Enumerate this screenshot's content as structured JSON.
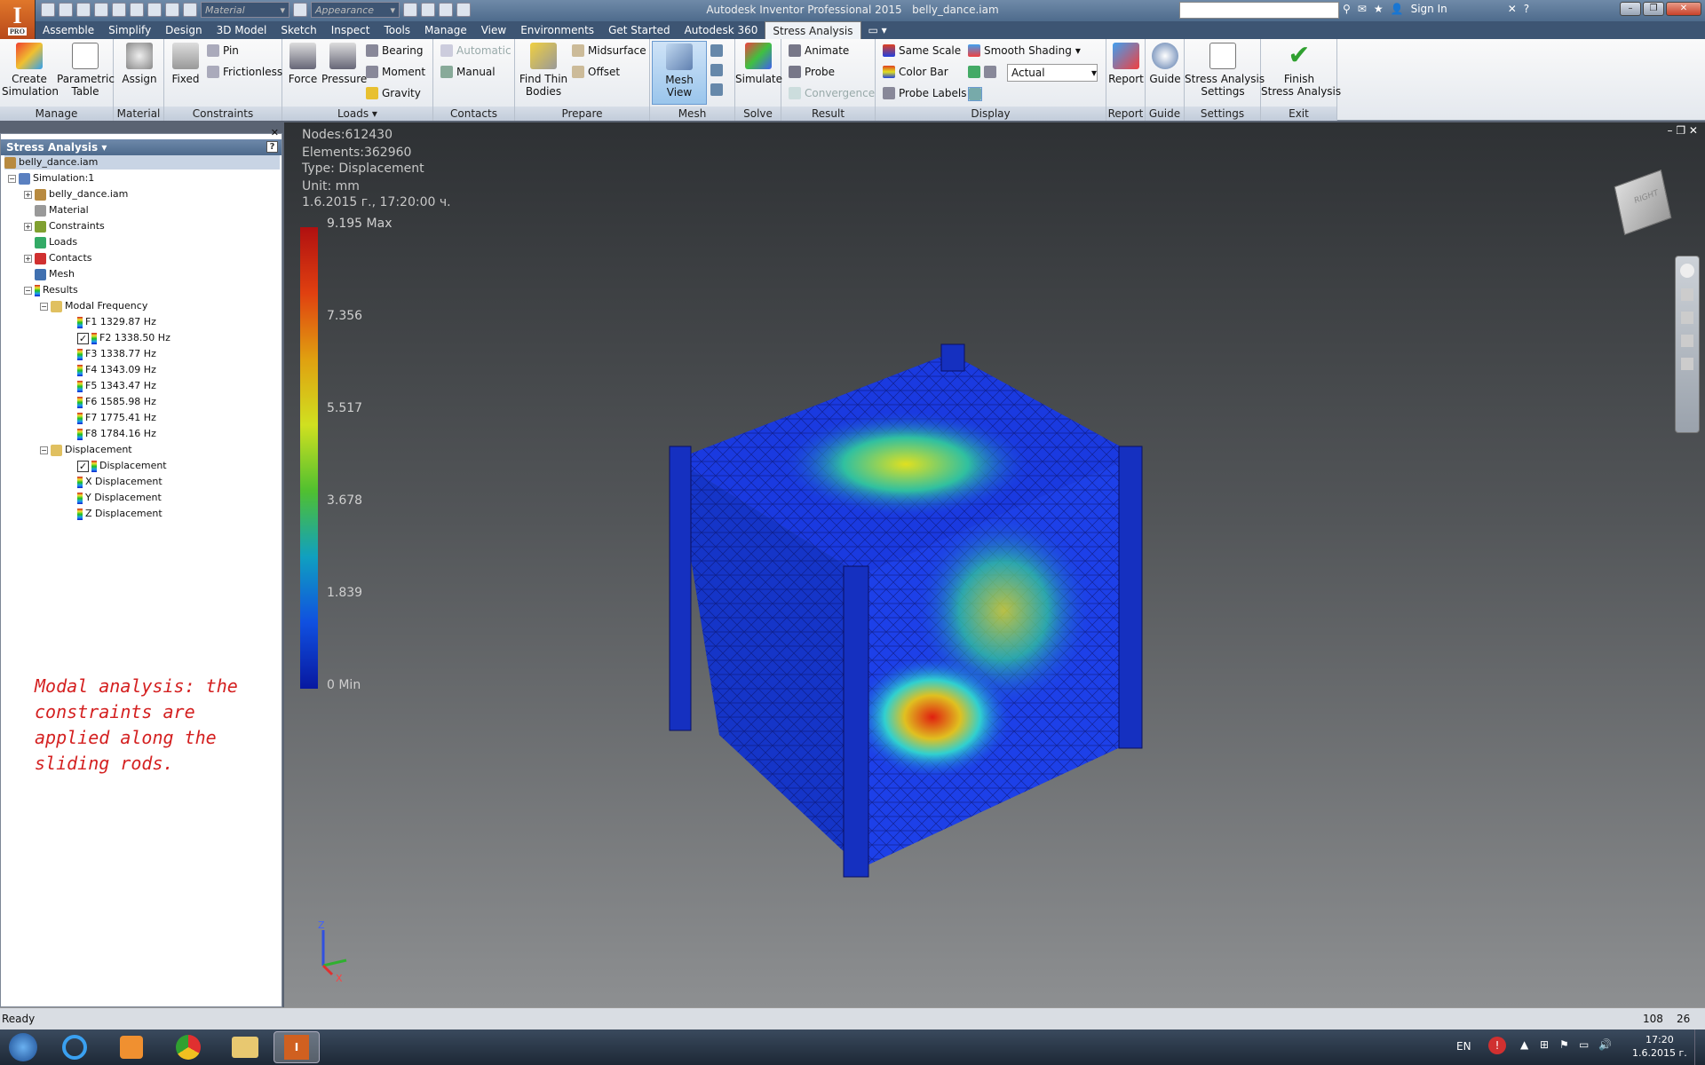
{
  "window": {
    "title": "Autodesk Inventor Professional 2015",
    "document": "belly_dance.iam",
    "logo_letter": "I",
    "logo_badge": "PRO",
    "sign_in": "Sign In"
  },
  "qat": {
    "material_placeholder": "Material",
    "appearance_placeholder": "Appearance"
  },
  "tabs": [
    "Assemble",
    "Simplify",
    "Design",
    "3D Model",
    "Sketch",
    "Inspect",
    "Tools",
    "Manage",
    "View",
    "Environments",
    "Get Started",
    "Autodesk 360",
    "Stress Analysis"
  ],
  "active_tab": "Stress Analysis",
  "ribbon": {
    "manage": {
      "label": "Manage",
      "create_simulation": "Create\nSimulation",
      "parametric_table": "Parametric\nTable"
    },
    "material": {
      "label": "Material",
      "assign": "Assign"
    },
    "constraints": {
      "label": "Constraints",
      "fixed": "Fixed",
      "pin": "Pin",
      "frictionless": "Frictionless"
    },
    "loads": {
      "label": "Loads",
      "force": "Force",
      "pressure": "Pressure",
      "bearing": "Bearing",
      "moment": "Moment",
      "gravity": "Gravity"
    },
    "contacts": {
      "label": "Contacts",
      "automatic": "Automatic",
      "manual": "Manual"
    },
    "prepare": {
      "label": "Prepare",
      "find_thin_bodies": "Find Thin\nBodies",
      "midsurface": "Midsurface",
      "offset": "Offset"
    },
    "mesh": {
      "label": "Mesh",
      "mesh_view": "Mesh View"
    },
    "solve": {
      "label": "Solve",
      "simulate": "Simulate"
    },
    "result": {
      "label": "Result",
      "animate": "Animate",
      "probe": "Probe",
      "convergence": "Convergence"
    },
    "display": {
      "label": "Display",
      "same_scale": "Same Scale",
      "color_bar": "Color Bar",
      "probe_labels": "Probe Labels",
      "shading": "Smooth Shading",
      "deformation": "Actual"
    },
    "report": {
      "label": "Report",
      "report": "Report"
    },
    "guide": {
      "label": "Guide",
      "guide": "Guide"
    },
    "settings": {
      "label": "Settings",
      "stress_settings": "Stress Analysis\nSettings"
    },
    "exit": {
      "label": "Exit",
      "finish": "Finish\nStress Analysis"
    }
  },
  "browser": {
    "title": "Stress Analysis",
    "help": "?",
    "root": "belly_dance.iam",
    "simulation": "Simulation:1",
    "assembly": "belly_dance.iam",
    "material": "Material",
    "constraints": "Constraints",
    "loads": "Loads",
    "contacts": "Contacts",
    "mesh": "Mesh",
    "results": "Results",
    "modal_frequency": "Modal Frequency",
    "frequencies": [
      {
        "label": "F1  1329.87 Hz",
        "checked": false
      },
      {
        "label": "F2  1338.50 Hz",
        "checked": true
      },
      {
        "label": "F3  1338.77 Hz",
        "checked": false
      },
      {
        "label": "F4  1343.09 Hz",
        "checked": false
      },
      {
        "label": "F5  1343.47 Hz",
        "checked": false
      },
      {
        "label": "F6  1585.98 Hz",
        "checked": false
      },
      {
        "label": "F7  1775.41 Hz",
        "checked": false
      },
      {
        "label": "F8  1784.16 Hz",
        "checked": false
      }
    ],
    "displacement_folder": "Displacement",
    "displacements": [
      {
        "label": "Displacement",
        "checked": true
      },
      {
        "label": "X Displacement",
        "checked": false
      },
      {
        "label": "Y Displacement",
        "checked": false
      },
      {
        "label": "Z Displacement",
        "checked": false
      }
    ]
  },
  "note": "Modal analysis: the constraints are applied along the sliding rods.",
  "viewport": {
    "nodes": "Nodes:612430",
    "elements": "Elements:362960",
    "type": "Type: Displacement",
    "unit": "Unit: mm",
    "date": "1.6.2015 г., 17:20:00 ч.",
    "legend": [
      "9.195 Max",
      "7.356",
      "5.517",
      "3.678",
      "1.839",
      "0 Min"
    ],
    "axis_z": "Z",
    "axis_x": "X",
    "viewcube_face": "RIGHT"
  },
  "status": {
    "text": "Ready",
    "num1": "108",
    "num2": "26"
  },
  "taskbar": {
    "lang": "EN",
    "time": "17:20",
    "date": "1.6.2015 г."
  }
}
